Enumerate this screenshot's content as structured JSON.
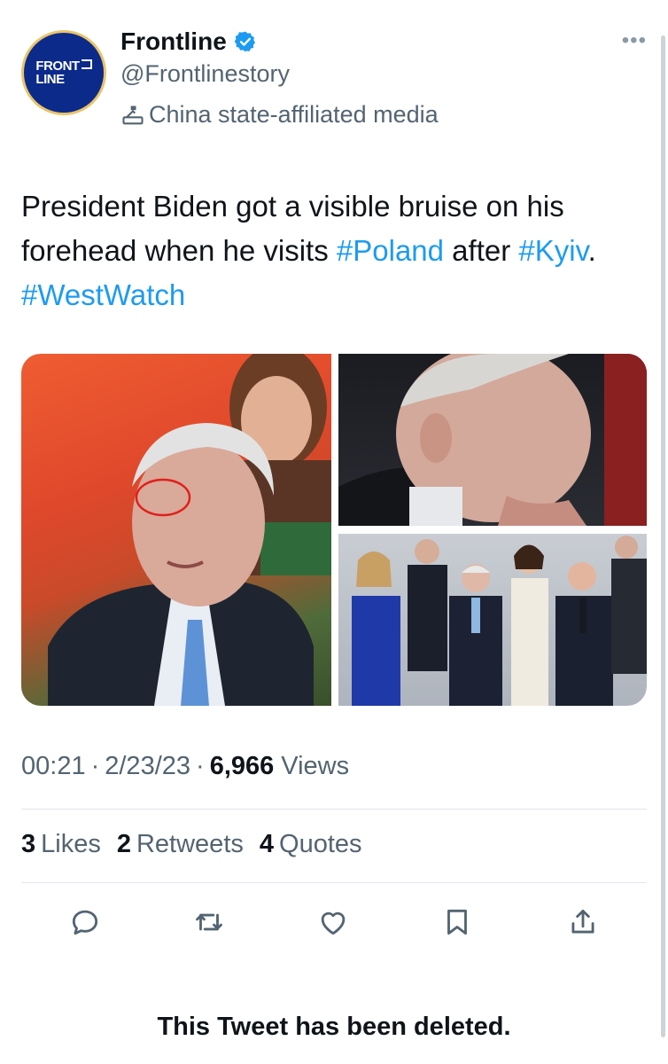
{
  "account": {
    "avatar_line1": "FRONT",
    "avatar_line2": "LINE",
    "display_name": "Frontline",
    "handle": "@Frontlinestory",
    "affiliation_label": "China state-affiliated media",
    "more_label": "•••"
  },
  "tweet": {
    "text_part1": "President Biden got a visible bruise on his forehead when he visits ",
    "hashtag1": "#Poland",
    "text_part2": " after ",
    "hashtag2": "#Kyiv",
    "text_part3": ". ",
    "hashtag3": "#WestWatch"
  },
  "meta": {
    "time": "00:21",
    "date": "2/23/23",
    "views_count": "6,966",
    "views_label": "Views",
    "separator": "·"
  },
  "stats": {
    "likes_count": "3",
    "likes_label": "Likes",
    "retweets_count": "2",
    "retweets_label": "Retweets",
    "quotes_count": "4",
    "quotes_label": "Quotes"
  },
  "icons": {
    "reply": "reply-icon",
    "retweet": "retweet-icon",
    "like": "heart-icon",
    "bookmark": "bookmark-icon",
    "share": "share-icon",
    "verified": "verified-badge-icon",
    "affiliation": "state-media-icon"
  },
  "colors": {
    "link": "#1d9bf0",
    "secondary_text": "#536471",
    "verified": "#1d9bf0",
    "avatar_bg": "#0b2a8a"
  },
  "footer": {
    "deleted_notice": "This Tweet has been deleted."
  }
}
